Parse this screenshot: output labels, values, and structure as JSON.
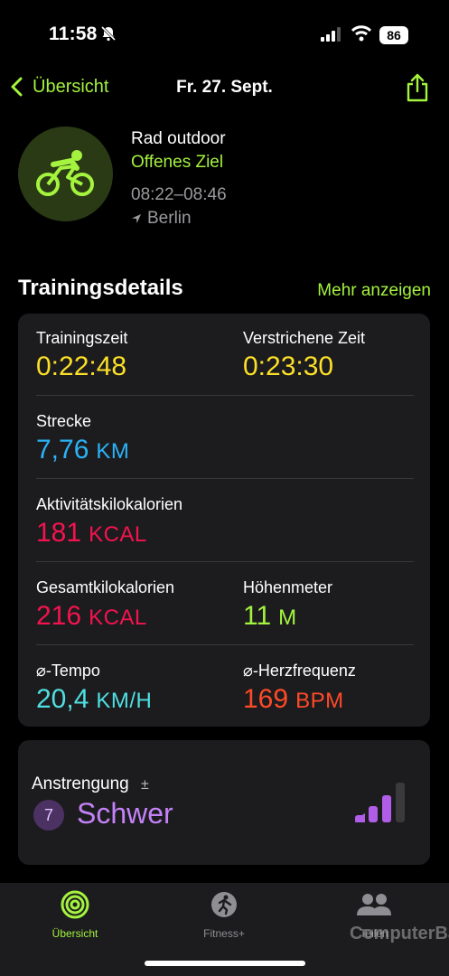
{
  "status_bar": {
    "time": "11:58",
    "battery": "86",
    "icons": [
      "bell-slash-icon",
      "signal-icon",
      "wifi-icon",
      "battery-icon"
    ]
  },
  "nav": {
    "back_label": "Übersicht",
    "title": "Fr. 27. Sept.",
    "share_icon": "share-icon"
  },
  "workout": {
    "icon": "cycling-icon",
    "type": "Rad outdoor",
    "goal": "Offenes Ziel",
    "time_range": "08:22–08:46",
    "location": "Berlin"
  },
  "details": {
    "title": "Trainingsdetails",
    "more": "Mehr anzeigen",
    "training_time": {
      "label": "Trainingszeit",
      "value": "0:22:48"
    },
    "elapsed_time": {
      "label": "Verstrichene Zeit",
      "value": "0:23:30"
    },
    "distance": {
      "label": "Strecke",
      "value": "7,76",
      "unit": "KM"
    },
    "active_kcal": {
      "label": "Aktivitätskilokalorien",
      "value": "181",
      "unit": "KCAL"
    },
    "total_kcal": {
      "label": "Gesamtkilokalorien",
      "value": "216",
      "unit": "KCAL"
    },
    "elevation": {
      "label": "Höhenmeter",
      "value": "11",
      "unit": "M"
    },
    "avg_speed": {
      "label": "⌀-Tempo",
      "value": "20,4",
      "unit": "KM/H"
    },
    "avg_hr": {
      "label": "⌀-Herzfrequenz",
      "value": "169",
      "unit": "BPM"
    }
  },
  "effort": {
    "label": "Anstrengung",
    "plusminus": "±",
    "level": "7",
    "level_text": "Schwer",
    "filled_bars": 3,
    "total_bars": 4
  },
  "tabs": [
    {
      "label": "Übersicht",
      "icon": "activity-rings-icon",
      "active": true
    },
    {
      "label": "Fitness+",
      "icon": "fitness-plus-icon",
      "active": false
    },
    {
      "label": "Teilen",
      "icon": "sharing-people-icon",
      "active": false
    }
  ],
  "watermark": "ComputerBase",
  "colors": {
    "accent": "#a4f33e",
    "yellow": "#fcdf27",
    "blue": "#2bb2f7",
    "red": "#f5134f",
    "teal": "#4fdfe1",
    "orange": "#ff4a28",
    "purple": "#c382f7"
  }
}
